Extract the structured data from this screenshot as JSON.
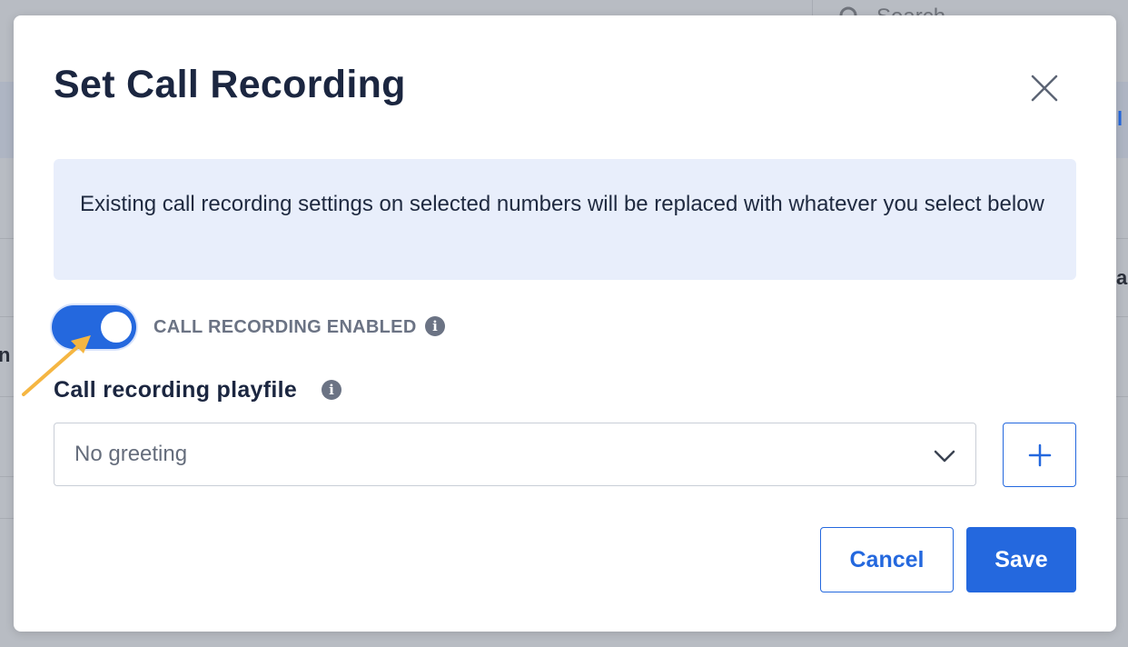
{
  "background": {
    "search_placeholder": "Search",
    "fragment_right_1": "l",
    "fragment_right_2": "a",
    "fragment_left": "n"
  },
  "modal": {
    "title": "Set Call Recording",
    "notice": "Existing call recording settings on selected numbers will be replaced with whatever you select below",
    "toggle": {
      "label": "CALL RECORDING ENABLED",
      "enabled": true
    },
    "playfile": {
      "label": "Call recording playfile",
      "selected": "No greeting"
    },
    "buttons": {
      "cancel": "Cancel",
      "save": "Save"
    }
  },
  "colors": {
    "accent": "#2468de",
    "title": "#1b2640",
    "notice_bg": "#e8eefb",
    "annotation_arrow": "#f5b642"
  },
  "icons": {
    "close": "close-icon",
    "info": "info-icon",
    "chevron": "chevron-down-icon",
    "add": "plus-icon",
    "search": "search-icon"
  }
}
